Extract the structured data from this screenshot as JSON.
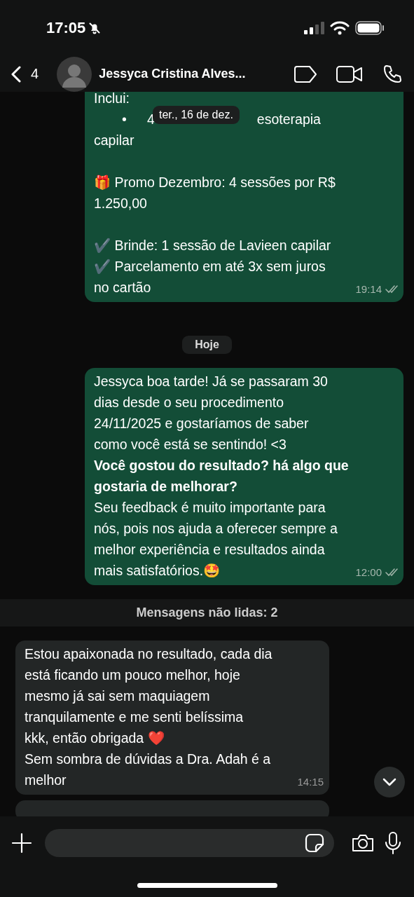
{
  "status_bar": {
    "time": "17:05"
  },
  "header": {
    "back_count": "4",
    "contact_name": "Jessyca Cristina Alves..."
  },
  "floating_date": "ter., 16 de dez.",
  "messages": [
    {
      "kind": "outgoing",
      "read": false,
      "time": "19:14",
      "paragraphs": [
        {
          "kind": "bullet",
          "lead": "Inclui:",
          "bullet": "•",
          "visible_start": "4",
          "visible_end": "esoterapia",
          "lines": [
            "capilar"
          ]
        },
        {
          "kind": "text",
          "lines": [
            "🎁 Promo Dezembro: 4 sessões por R$",
            "1.250,00"
          ]
        },
        {
          "kind": "text",
          "lines": [
            "✔️ Brinde: 1 sessão de Lavieen capilar",
            "✔️ Parcelamento em até 3x sem juros",
            "no cartão"
          ]
        }
      ]
    },
    {
      "kind": "date",
      "text": "Hoje"
    },
    {
      "kind": "outgoing",
      "read": false,
      "time": "12:00",
      "paragraphs": [
        {
          "kind": "text",
          "lines": [
            "Jessyca boa tarde! Já se passaram 30",
            "dias desde o seu procedimento",
            "24/11/2025 e gostaríamos de saber",
            "como você está se sentindo! <3",
            "**Você gostou do resultado? há algo que**",
            "**gostaria de melhorar?**",
            "Seu feedback é muito importante para",
            "nós, pois nos ajuda a oferecer sempre a",
            "melhor experiência e resultados ainda",
            "mais satisfatórios.🤩"
          ]
        }
      ]
    },
    {
      "kind": "unread",
      "text": "Mensagens não lidas: 2"
    },
    {
      "kind": "incoming",
      "time": "14:15",
      "paragraphs": [
        {
          "kind": "text",
          "lines": [
            "Estou apaixonada no resultado, cada dia",
            "está ficando um pouco melhor, hoje",
            "mesmo já sai sem maquiagem",
            "tranquilamente e me senti belíssima",
            "kkk, então obrigada ❤️",
            "Sem sombra de dúvidas a Dra. Adah é a",
            "melhor"
          ]
        }
      ]
    },
    {
      "kind": "incoming_partial"
    }
  ]
}
